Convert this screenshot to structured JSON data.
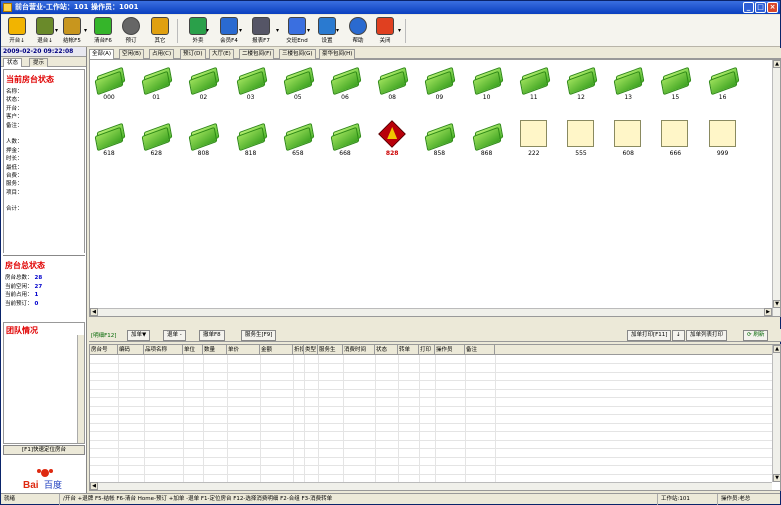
{
  "titlebar": {
    "title": "前台营业-工作站：101 操作员：1001"
  },
  "toolbar": {
    "items": [
      {
        "label": "开台↓",
        "icon": "key-icon"
      },
      {
        "label": "退台↓",
        "icon": "door-exit-icon"
      },
      {
        "label": "结帐F5",
        "icon": "money-bag-icon"
      },
      {
        "label": "清台F6",
        "icon": "clean-book-icon"
      },
      {
        "label": "预订",
        "icon": "clock-icon"
      },
      {
        "label": "其它",
        "icon": "heart-icon"
      },
      {
        "label": "外卖",
        "icon": "takeout-icon"
      },
      {
        "label": "会员F4",
        "icon": "member-icon"
      },
      {
        "label": "报表F7",
        "icon": "report-icon"
      },
      {
        "label": "交班End",
        "icon": "handover-icon"
      },
      {
        "label": "设置",
        "icon": "settings-icon"
      },
      {
        "label": "帮助",
        "icon": "help-icon"
      },
      {
        "label": "关闭",
        "icon": "close-icon"
      }
    ]
  },
  "left": {
    "datetime": "2009-02-20 09:22:08",
    "tabs": [
      "状态",
      "提示"
    ],
    "current_title": "当前房台状态",
    "fields": [
      "名称：",
      "状态：",
      "开台：",
      "客户：",
      "备注：",
      "",
      "人数：",
      "押金：",
      "时长：",
      "最低：",
      "台费：",
      "服务：",
      "项目：",
      "",
      "合计："
    ],
    "total_title": "房台总状态",
    "totals": [
      {
        "label": "房台总数：",
        "value": "28"
      },
      {
        "label": "当前空闲：",
        "value": "27"
      },
      {
        "label": "当前占用：",
        "value": "1"
      },
      {
        "label": "当前预订：",
        "value": "0"
      }
    ],
    "team_title": "团队情况",
    "quick_locate": "[F1]快速定位房台",
    "logo": "Bai百度"
  },
  "room_tabs": [
    "全部(A)",
    "空闲(B)",
    "占用(C)",
    "预订(D)",
    "大厅(E)",
    "二楼包间(F)",
    "三楼包间(G)",
    "豪华包间(H)"
  ],
  "rooms": [
    {
      "name": "000",
      "state": "idle"
    },
    {
      "name": "01",
      "state": "idle"
    },
    {
      "name": "02",
      "state": "idle"
    },
    {
      "name": "03",
      "state": "idle"
    },
    {
      "name": "05",
      "state": "idle"
    },
    {
      "name": "06",
      "state": "idle"
    },
    {
      "name": "08",
      "state": "idle"
    },
    {
      "name": "09",
      "state": "idle"
    },
    {
      "name": "10",
      "state": "idle"
    },
    {
      "name": "11",
      "state": "idle"
    },
    {
      "name": "12",
      "state": "idle"
    },
    {
      "name": "13",
      "state": "idle"
    },
    {
      "name": "15",
      "state": "idle"
    },
    {
      "name": "16",
      "state": "idle"
    },
    {
      "name": "618",
      "state": "idle"
    },
    {
      "name": "628",
      "state": "idle"
    },
    {
      "name": "808",
      "state": "idle"
    },
    {
      "name": "818",
      "state": "idle"
    },
    {
      "name": "658",
      "state": "idle"
    },
    {
      "name": "668",
      "state": "idle"
    },
    {
      "name": "828",
      "state": "busy"
    },
    {
      "name": "858",
      "state": "idle"
    },
    {
      "name": "868",
      "state": "idle"
    },
    {
      "name": "222",
      "state": "free"
    },
    {
      "name": "555",
      "state": "free"
    },
    {
      "name": "608",
      "state": "free"
    },
    {
      "name": "666",
      "state": "free"
    },
    {
      "name": "999",
      "state": "free"
    }
  ],
  "orderbar": {
    "label": "[明细F12]",
    "add": "加单▼",
    "return": "退单 -",
    "cancel": "撤单F8",
    "service": "服务生[F9]",
    "print_add": "加单打印[F11]",
    "print_list": "加单列表打印",
    "refresh": "刷新"
  },
  "detail_columns": [
    "房台号",
    "编码",
    "品项名称",
    "单位",
    "数量",
    "单价",
    "金额",
    "折扣",
    "类型",
    "服务生",
    "消费时间",
    "状态",
    "转单",
    "打印",
    "操作员",
    "备注"
  ],
  "statusbar": {
    "ready": "就绪",
    "hints": "/开台 +退牌 F5-结帐 F6-清台 Home-预订 +加单 -退单 F1-定位房台 F12-选择消费明细 F2-合组 F3-消费转单",
    "station": "工作站:101",
    "operator": "操作员:老总"
  }
}
